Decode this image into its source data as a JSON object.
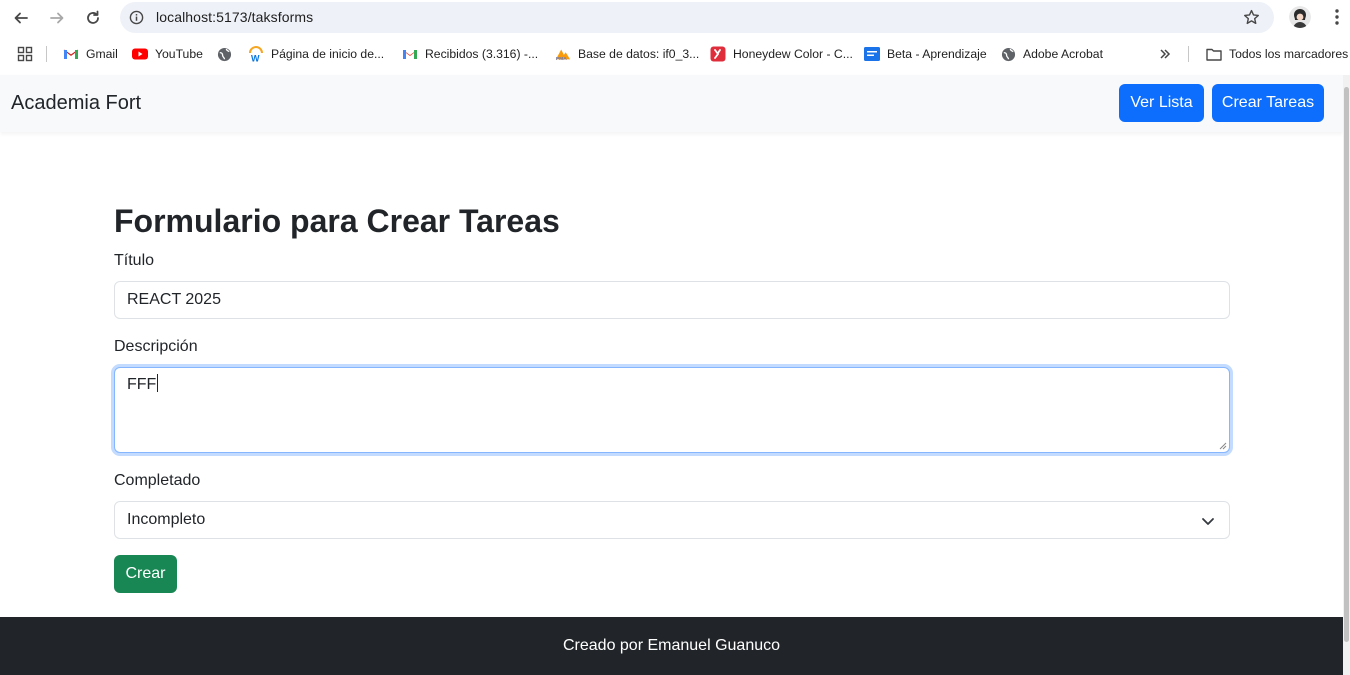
{
  "browser": {
    "url": "localhost:5173/taksforms",
    "bookmarks": [
      {
        "label": "Gmail",
        "icon": "gmail-icon"
      },
      {
        "label": "YouTube",
        "icon": "youtube-icon"
      },
      {
        "label": "",
        "icon": "globe-icon"
      },
      {
        "label": "Página de inicio de...",
        "icon": "workday-icon"
      },
      {
        "label": "Recibidos (3.316) -...",
        "icon": "gmail-icon"
      },
      {
        "label": "Base de datos: if0_3...",
        "icon": "phpmyadmin-icon"
      },
      {
        "label": "Honeydew Color - C...",
        "icon": "honeydew-icon"
      },
      {
        "label": "Beta - Aprendizaje",
        "icon": "beta-icon"
      },
      {
        "label": "Adobe Acrobat",
        "icon": "globe-icon"
      }
    ],
    "all_bookmarks": "Todos los marcadores"
  },
  "navbar": {
    "brand": "Academia Fort",
    "ver_lista": "Ver Lista",
    "crear_tareas": "Crear Tareas"
  },
  "form": {
    "title": "Formulario para Crear Tareas",
    "titulo_label": "Título",
    "titulo_value": "REACT 2025",
    "descripcion_label": "Descripción",
    "descripcion_value": "FFF",
    "completado_label": "Completado",
    "completado_value": "Incompleto",
    "submit": "Crear"
  },
  "footer": {
    "text": "Creado por Emanuel Guanuco"
  },
  "colors": {
    "primary": "#0d6efd",
    "success": "#198754",
    "footer_bg": "#212529",
    "navbar_bg": "#f8f9fa"
  }
}
